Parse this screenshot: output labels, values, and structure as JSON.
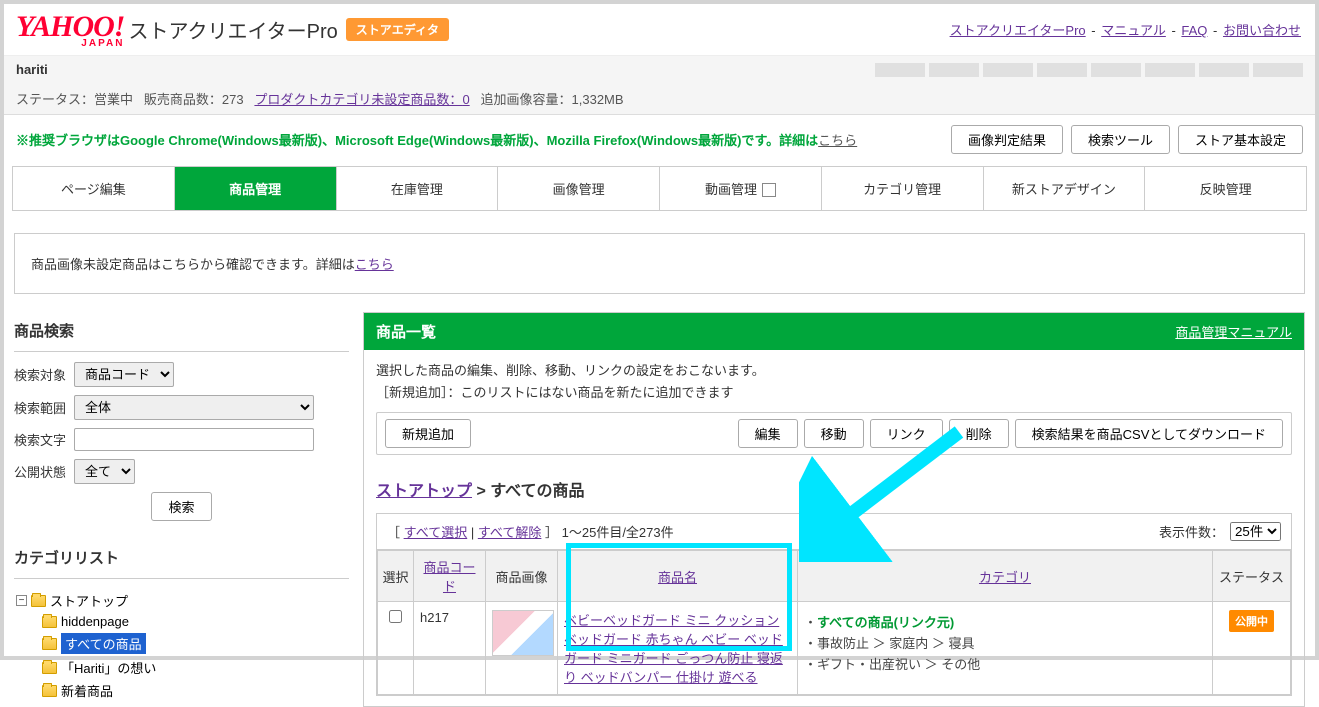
{
  "header": {
    "logo_main": "YAHOO!",
    "logo_sub": "JAPAN",
    "title": "ストアクリエイターPro",
    "editor_badge": "ストアエディタ",
    "links": {
      "creator": "ストアクリエイターPro",
      "manual": "マニュアル",
      "faq": "FAQ",
      "contact": "お問い合わせ"
    }
  },
  "store": {
    "name": "hariti"
  },
  "status": {
    "label": "ステータス：営業中",
    "products_label": "販売商品数：",
    "products_count": "273",
    "uncat_label": "プロダクトカテゴリ未設定商品数：",
    "uncat_count": "0",
    "image_cap": "追加画像容量：1,332MB"
  },
  "browser_note": {
    "text": "※推奨ブラウザはGoogle Chrome(Windows最新版)、Microsoft Edge(Windows最新版)、Mozilla Firefox(Windows最新版)です。詳細は",
    "link": "こちら"
  },
  "toolbar": {
    "btn_image": "画像判定結果",
    "btn_search_tool": "検索ツール",
    "btn_store_basic": "ストア基本設定"
  },
  "tabs": {
    "page_edit": "ページ編集",
    "product_mgmt": "商品管理",
    "stock_mgmt": "在庫管理",
    "image_mgmt": "画像管理",
    "video_mgmt": "動画管理",
    "category_mgmt": "カテゴリ管理",
    "new_design": "新ストアデザイン",
    "reflect_mgmt": "反映管理"
  },
  "notice": {
    "prefix": "商品画像未設定商品はこちらから確認できます。詳細は",
    "link": "こちら"
  },
  "search_panel": {
    "title": "商品検索",
    "target_label": "検索対象",
    "target_value": "商品コード",
    "range_label": "検索範囲",
    "range_value": "全体",
    "keyword_label": "検索文字",
    "publish_label": "公開状態",
    "publish_value": "全て",
    "search_btn": "検索"
  },
  "category_panel": {
    "title": "カテゴリリスト",
    "items": {
      "root": "ストアトップ",
      "hidden": "hiddenpage",
      "all": "すべての商品",
      "hariti": "「Hariti」の想い",
      "new": "新着商品"
    }
  },
  "main": {
    "header_title": "商品一覧",
    "header_manual": "商品管理マニュアル",
    "desc_line1": "選択した商品の編集、削除、移動、リンクの設定をおこないます。",
    "desc_line2": "［新規追加］：このリストにはない商品を新たに追加できます",
    "actions": {
      "add": "新規追加",
      "edit": "編集",
      "move": "移動",
      "link": "リンク",
      "delete": "削除",
      "csv": "検索結果を商品CSVとしてダウンロード"
    },
    "breadcrumb": {
      "top": "ストアトップ",
      "sep": " > ",
      "current": "すべての商品"
    },
    "list": {
      "select_all": "すべて選択",
      "deselect_all": "すべて解除",
      "range_text": "1～25件目/全273件",
      "per_page_label": "表示件数：",
      "per_page_value": "25件"
    },
    "table": {
      "headers": {
        "select": "選択",
        "code": "商品コード",
        "image": "商品画像",
        "name": "商品名",
        "category": "カテゴリ",
        "status": "ステータス"
      },
      "row": {
        "code": "h217",
        "name": "ベビーベッドガード ミニ クッション ベッドガード 赤ちゃん ベビー ベッドガード ミニガード ごっつん防止 寝返り ベッドバンパー 仕掛け 遊べる",
        "cat_main": "すべての商品(リンク元)",
        "cat_line1": "事故防止 ＞ 家庭内 ＞ 寝具",
        "cat_line2": "ギフト・出産祝い ＞ その他",
        "status": "公開中"
      }
    }
  },
  "sep": " - "
}
